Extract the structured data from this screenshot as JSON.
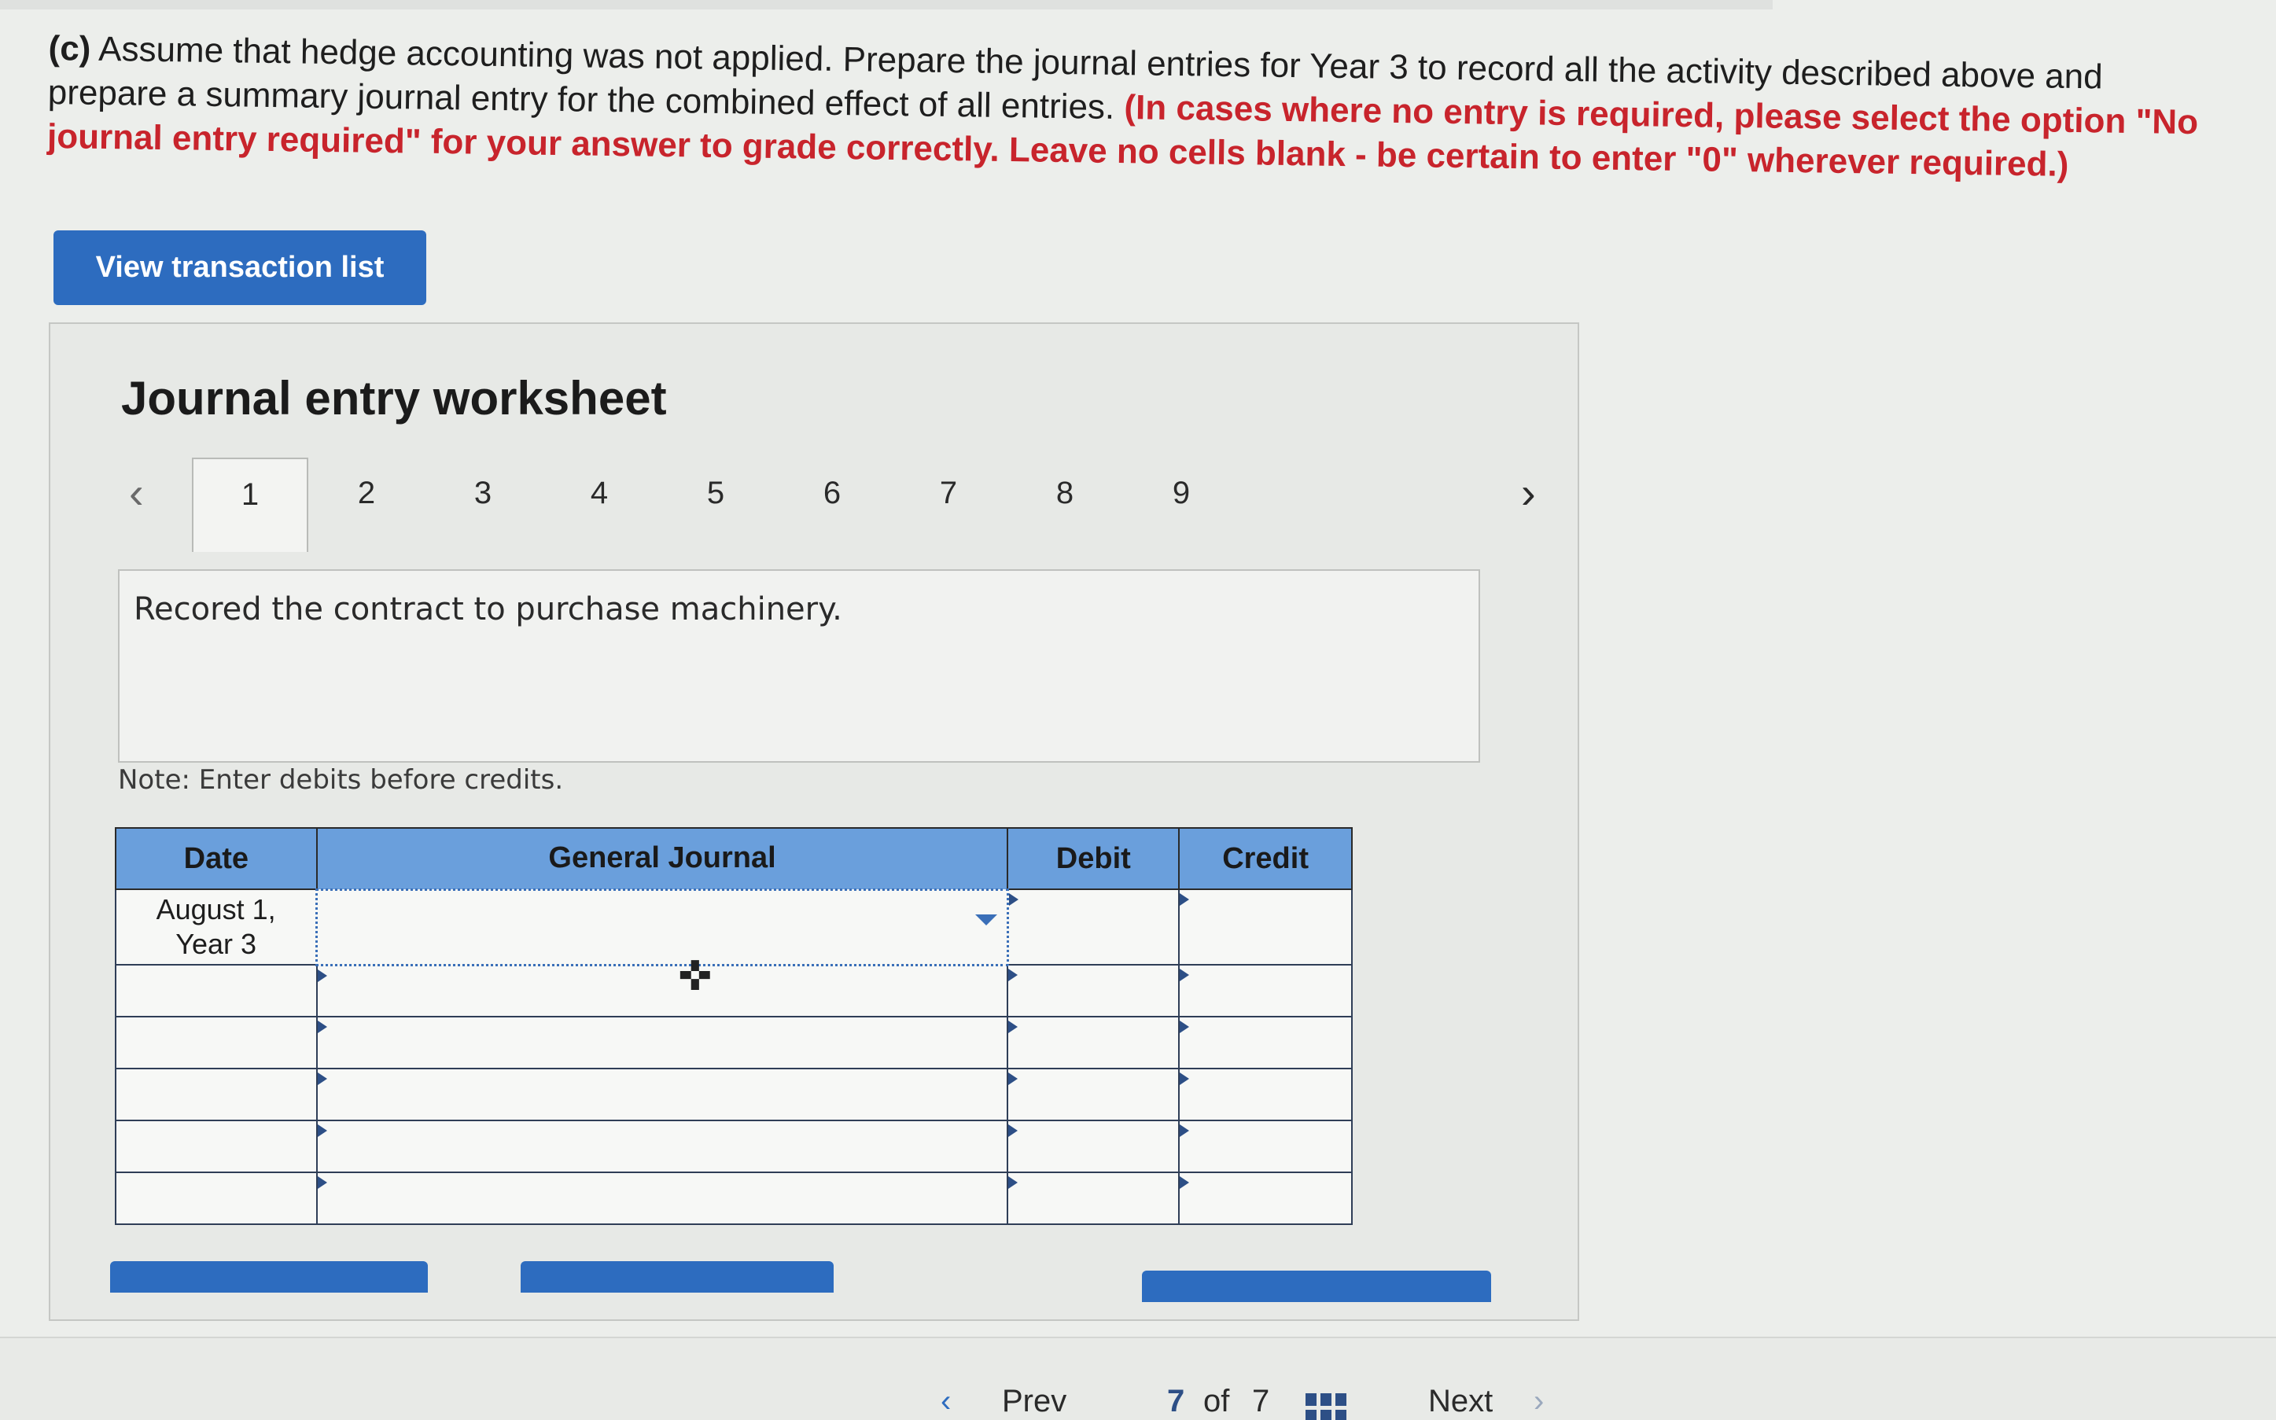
{
  "question": {
    "lead": "(c)",
    "text": "Assume that hedge accounting was not applied. Prepare the journal entries for Year 3 to record all the activity described above and prepare a summary journal entry for the combined effect of all entries.",
    "instruction": "(In cases where no entry is required, please select the option \"No journal entry required\" for your answer to grade correctly. Leave no cells blank - be certain to enter \"0\" wherever required.)"
  },
  "view_button": "View transaction list",
  "worksheet": {
    "title": "Journal entry worksheet",
    "tabs": [
      "1",
      "2",
      "3",
      "4",
      "5",
      "6",
      "7",
      "8",
      "9"
    ],
    "active_tab": "1",
    "description": "Recored the contract to purchase machinery.",
    "note": "Note: Enter debits before credits."
  },
  "table": {
    "headers": {
      "date": "Date",
      "journal": "General Journal",
      "debit": "Debit",
      "credit": "Credit"
    },
    "first_date_line1": "August 1,",
    "first_date_line2": "Year 3"
  },
  "footer": {
    "prev": "Prev",
    "page": "7",
    "of": "of",
    "total": "7",
    "next": "Next"
  },
  "colors": {
    "accent": "#2d6cbf",
    "header_blue": "#6a9fdc",
    "instruction_red": "#c8242c"
  }
}
